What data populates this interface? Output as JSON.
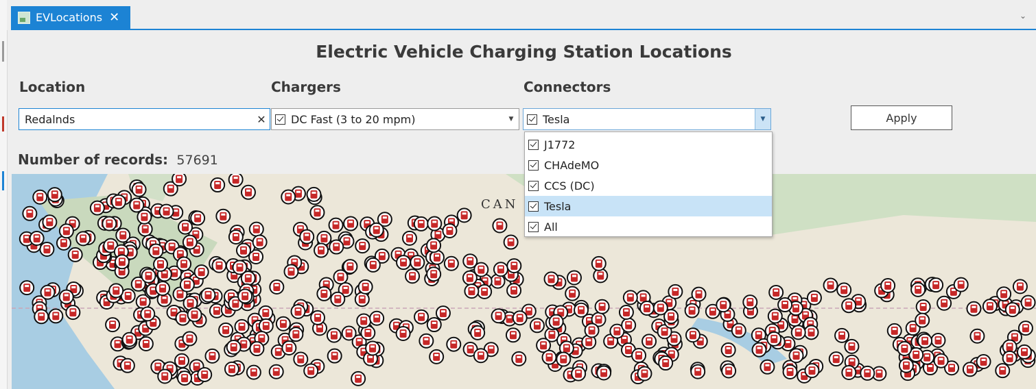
{
  "tab": {
    "title": "EVLocations"
  },
  "panel": {
    "title": "Electric Vehicle Charging Station Locations",
    "location_label": "Location",
    "chargers_label": "Chargers",
    "connectors_label": "Connectors",
    "location_value": "Redalnds",
    "chargers_value": "DC Fast (3 to 20 mpm)",
    "connectors_value": "Tesla",
    "apply_label": "Apply",
    "records_label": "Number of records:",
    "records_value": "57691"
  },
  "connectors_options": [
    {
      "label": "J1772",
      "checked": true
    },
    {
      "label": "CHAdeMO",
      "checked": true
    },
    {
      "label": "CCS (DC)",
      "checked": true
    },
    {
      "label": "Tesla",
      "checked": true,
      "selected": true
    },
    {
      "label": "All",
      "checked": true
    }
  ],
  "map": {
    "country_label": "CAN",
    "marker_color": "#c62828"
  }
}
